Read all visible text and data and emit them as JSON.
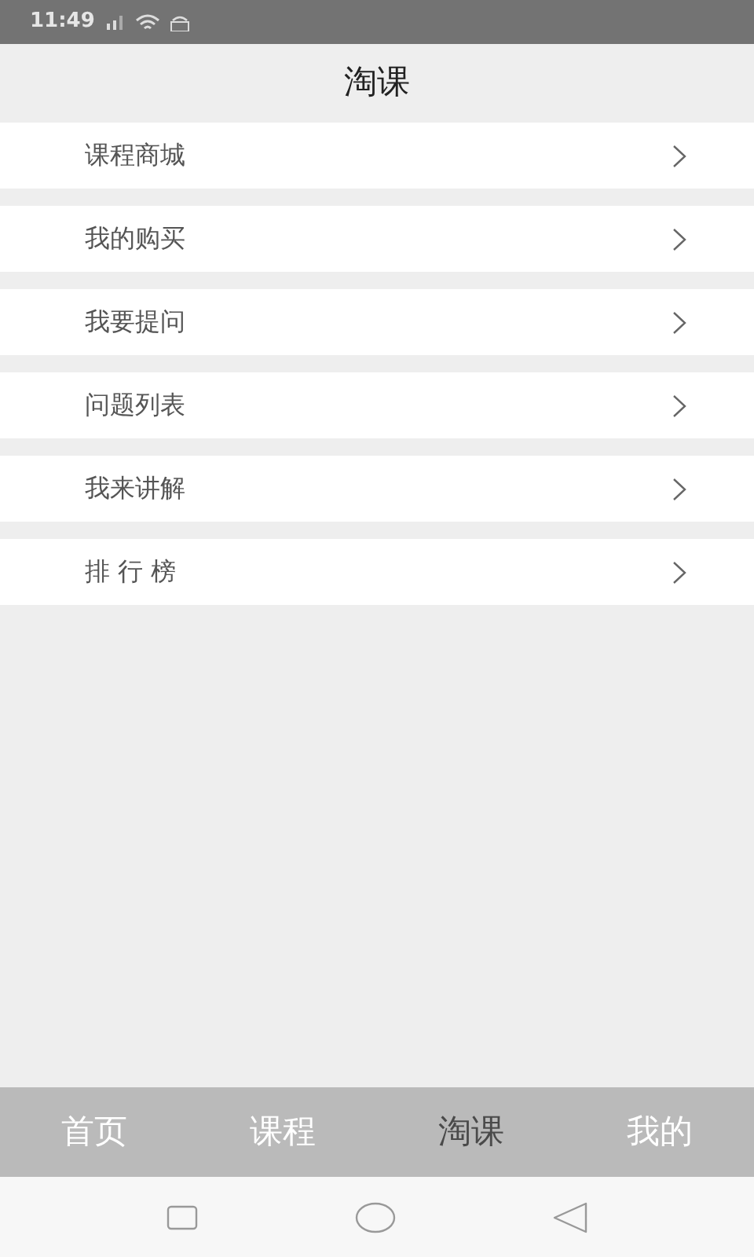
{
  "status_bar": {
    "time": "11:49"
  },
  "header": {
    "title": "淘课"
  },
  "menu": [
    {
      "label": "课程商城"
    },
    {
      "label": "我的购买"
    },
    {
      "label": "我要提问"
    },
    {
      "label": "问题列表"
    },
    {
      "label": "我来讲解"
    },
    {
      "label": "排 行 榜"
    }
  ],
  "tabs": [
    {
      "label": "首页",
      "selected": false
    },
    {
      "label": "课程",
      "selected": false
    },
    {
      "label": "淘课",
      "selected": true
    },
    {
      "label": "我的",
      "selected": false
    }
  ]
}
